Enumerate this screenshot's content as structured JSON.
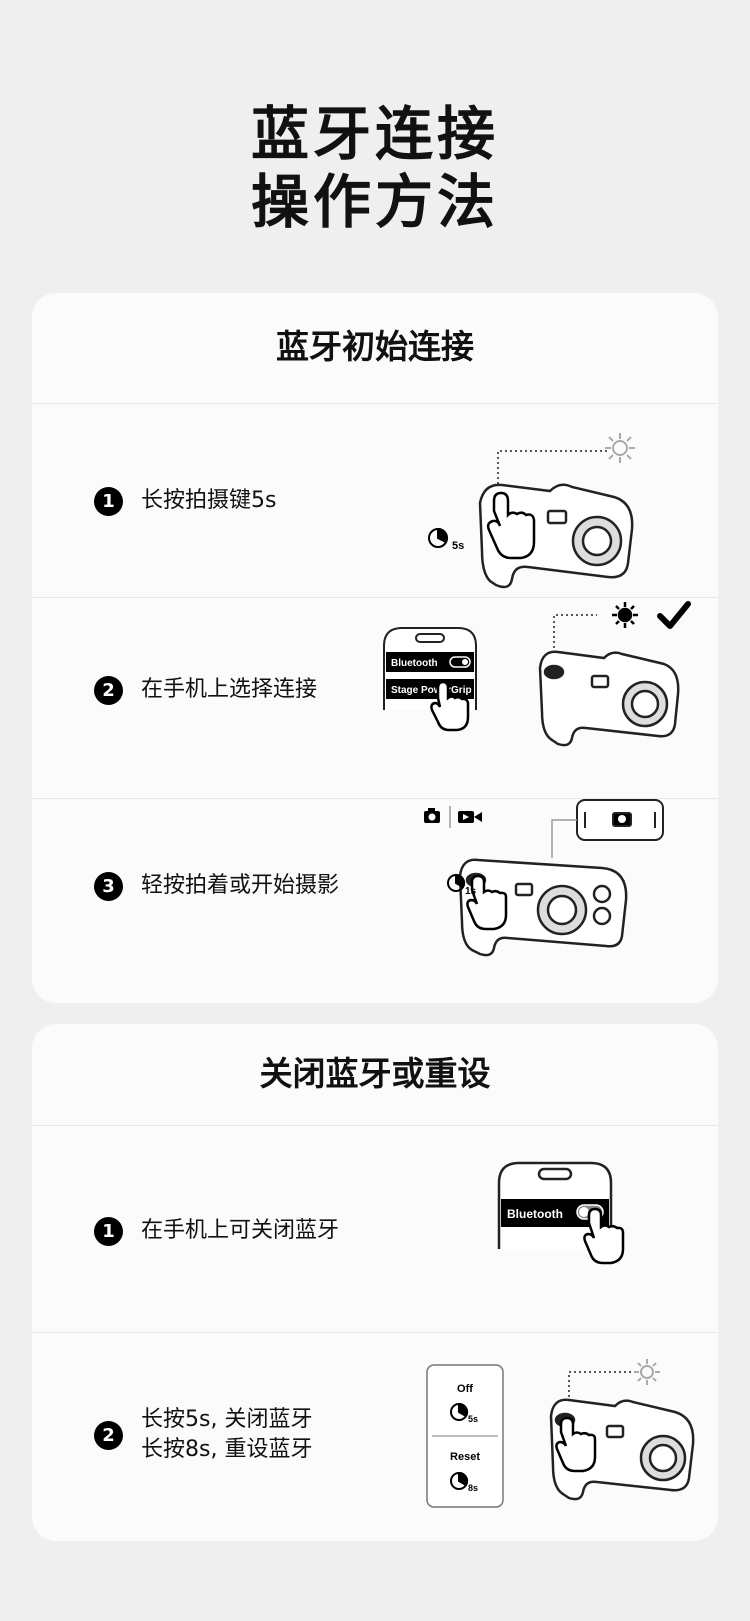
{
  "header": {
    "title_line1": "蓝牙连接",
    "title_line2": "操作方法"
  },
  "section1": {
    "title": "蓝牙初始连接",
    "steps": [
      {
        "num": "1",
        "text": "长按拍摄键5s",
        "timer": "5s"
      },
      {
        "num": "2",
        "text": "在手机上选择连接",
        "phone_toggle_label": "Bluetooth",
        "phone_device_label": "Stage PowerGrip"
      },
      {
        "num": "3",
        "text": "轻按拍着或开始摄影",
        "timer": "1s"
      }
    ]
  },
  "section2": {
    "title": "关闭蓝牙或重设",
    "steps": [
      {
        "num": "1",
        "text": "在手机上可关闭蓝牙",
        "phone_toggle_label": "Bluetooth"
      },
      {
        "num": "2",
        "lines": [
          "长按5s, 关闭蓝牙",
          "长按8s, 重设蓝牙"
        ],
        "off_label": "Off",
        "off_timer": "5s",
        "reset_label": "Reset",
        "reset_timer": "8s"
      }
    ]
  }
}
